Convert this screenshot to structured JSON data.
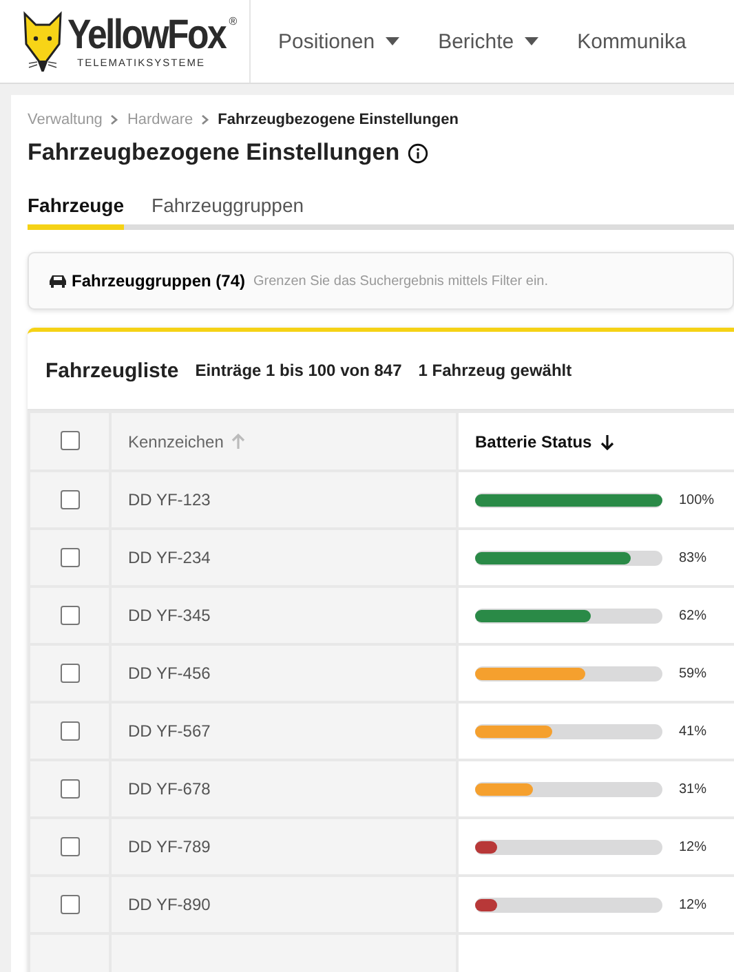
{
  "logo": {
    "name": "YellowFox",
    "mark": "®",
    "tagline": "TELEMATIKSYSTEME"
  },
  "nav": [
    {
      "label": "Positionen",
      "dropdown": true
    },
    {
      "label": "Berichte",
      "dropdown": true
    },
    {
      "label": "Kommunika",
      "dropdown": false
    }
  ],
  "breadcrumb": [
    {
      "label": "Verwaltung",
      "current": false
    },
    {
      "label": "Hardware",
      "current": false
    },
    {
      "label": "Fahrzeugbezogene Einstellungen",
      "current": true
    }
  ],
  "title": "Fahrzeugbezogene Einstellungen",
  "tabs": [
    {
      "label": "Fahrzeuge",
      "selected": true
    },
    {
      "label": "Fahrzeuggruppen",
      "selected": false
    }
  ],
  "filter": {
    "label": "Fahrzeuggruppen (74)",
    "hint": "Grenzen Sie das Suchergebnis mittels Filter ein."
  },
  "list": {
    "title": "Fahrzeugliste",
    "entries": "Einträge 1 bis 100 von 847",
    "selection": "1 Fahrzeug gewählt"
  },
  "table": {
    "columns": [
      {
        "label": "Kennzeichen",
        "descending": false,
        "active": false
      },
      {
        "label": "Batterie Status",
        "descending": true,
        "active": true
      }
    ],
    "all_checked": false,
    "rows": [
      {
        "plate": "DD YF-123",
        "level": 1.0,
        "reading": "100%",
        "color": "#2a8a47",
        "checked": false
      },
      {
        "plate": "DD YF-234",
        "level": 0.83,
        "reading": "83%",
        "color": "#2a8a47",
        "checked": false
      },
      {
        "plate": "DD YF-345",
        "level": 0.62,
        "reading": "62%",
        "color": "#2a8a47",
        "checked": false
      },
      {
        "plate": "DD YF-456",
        "level": 0.59,
        "reading": "59%",
        "color": "#f5a02e",
        "checked": false
      },
      {
        "plate": "DD YF-567",
        "level": 0.41,
        "reading": "41%",
        "color": "#f5a02e",
        "checked": false
      },
      {
        "plate": "DD YF-678",
        "level": 0.31,
        "reading": "31%",
        "color": "#f5a02e",
        "checked": false
      },
      {
        "plate": "DD YF-789",
        "level": 0.12,
        "reading": "12%",
        "color": "#b83838",
        "checked": false
      },
      {
        "plate": "DD YF-890",
        "level": 0.12,
        "reading": "12%",
        "color": "#b83838",
        "checked": false
      }
    ]
  }
}
